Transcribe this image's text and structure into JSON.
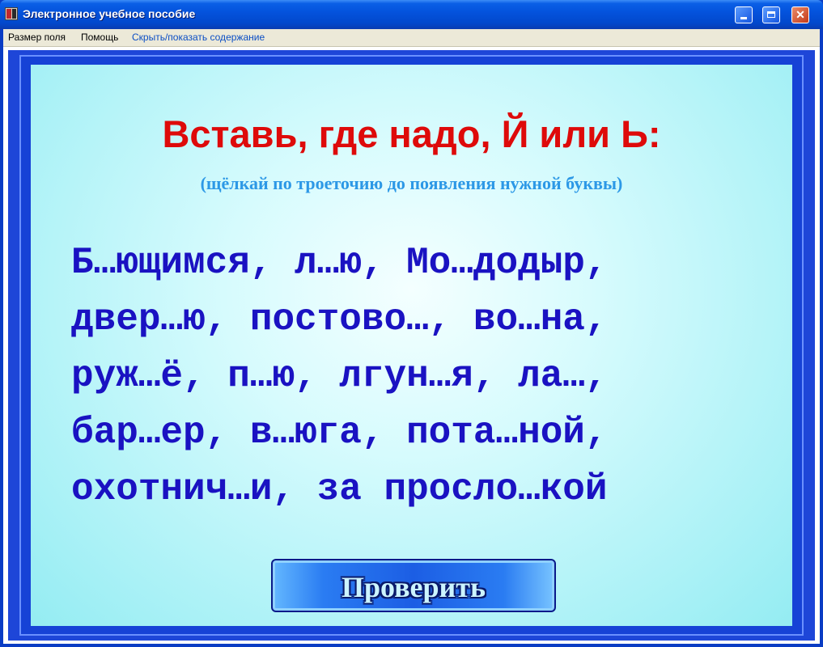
{
  "window": {
    "title": "Электронное учебное пособие",
    "close_glyph": "✕"
  },
  "menu": {
    "items": [
      {
        "label": "Размер поля"
      },
      {
        "label": "Помощь"
      },
      {
        "label": "Скрыть/показать содержание"
      }
    ]
  },
  "exercise": {
    "heading": "Вставь, где надо, Й или Ь:",
    "hint": "(щёлкай по троеточию до появления нужной буквы)",
    "lines": [
      "Б…ющимся, л…ю, Мо…додыр,",
      "двер…ю, постово…, во…на,",
      "руж…ё, п…ю, лгун…я, ла…,",
      "бар…ер, в…юга, пота…ной,",
      "охотнич…и, за просло…кой"
    ],
    "check_button": "Проверить"
  },
  "colors": {
    "heading": "#de0a0a",
    "hint": "#2c98e6",
    "exercise_text": "#1a12c2",
    "frame": "#1642d6",
    "panel": "#c4f7fa"
  }
}
